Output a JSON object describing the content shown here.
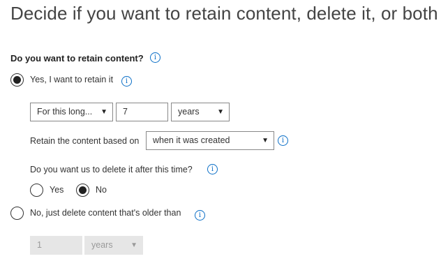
{
  "title": "Decide if you want to retain content, delete it, or both",
  "retain_question": "Do you want to retain content?",
  "options": {
    "yes_label": "Yes, I want to retain it",
    "no_label": "No, just delete content that's older than"
  },
  "retain_period": {
    "mode_value": "For this long...",
    "amount_value": "7",
    "unit_value": "years"
  },
  "retain_based_on": {
    "label": "Retain the content based on",
    "value": "when it was created"
  },
  "delete_question": {
    "label": "Do you want us to delete it after this time?",
    "yes_label": "Yes",
    "no_label": "No"
  },
  "delete_period": {
    "amount_value": "1",
    "unit_value": "years"
  },
  "icons": {
    "info": "i",
    "arrow": "▼"
  },
  "colors": {
    "accent": "#0b6fc7",
    "disabled_bg": "#e6e6e6"
  }
}
